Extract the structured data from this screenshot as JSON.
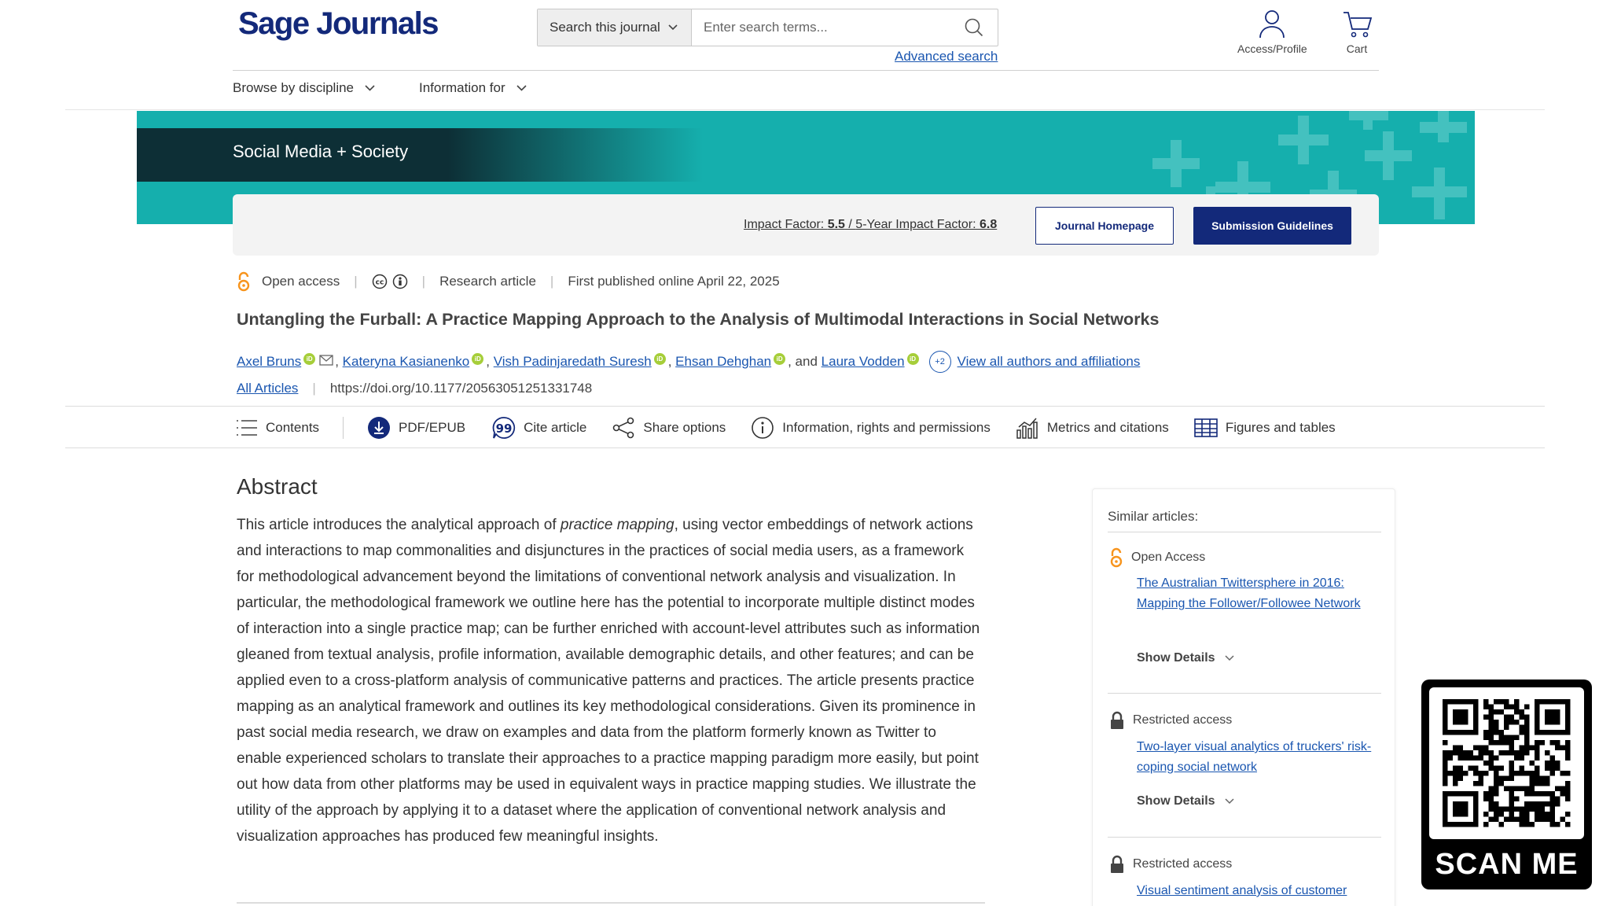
{
  "header": {
    "logo": "Sage Journals",
    "search_scope": "Search this journal",
    "search_placeholder": "Enter search terms...",
    "advanced_search": "Advanced search",
    "access_profile": "Access/Profile",
    "cart": "Cart"
  },
  "nav": {
    "browse": "Browse by discipline",
    "information": "Information for"
  },
  "journal": {
    "name": "Social Media + Society",
    "impact_label": "Impact Factor: ",
    "impact_value": "5.5",
    "impact_sep": " / ",
    "five_year_label": "5-Year Impact Factor: ",
    "five_year_value": "6.8",
    "homepage_button": "Journal Homepage",
    "guidelines_button": "Submission Guidelines"
  },
  "article": {
    "access": "Open access",
    "type": "Research article",
    "published": "First published online April 22, 2025",
    "title": "Untangling the Furball: A Practice Mapping Approach to the Analysis of Multimodal Interactions in Social Networks",
    "authors": [
      "Axel Bruns",
      "Kateryna Kasianenko",
      "Vish Padinjaredath Suresh",
      "Ehsan Dehghan",
      "Laura Vodden"
    ],
    "and_text": ", and ",
    "more_count": "+2",
    "view_all": "View all authors and affiliations",
    "all_articles": "All Articles",
    "doi": "https://doi.org/10.1177/20563051251331748"
  },
  "toolbar": {
    "contents": "Contents",
    "pdf": "PDF/EPUB",
    "cite": "Cite article",
    "share": "Share options",
    "info": "Information, rights and permissions",
    "metrics": "Metrics and citations",
    "figures": "Figures and tables"
  },
  "abstract": {
    "heading": "Abstract",
    "text_before": "This article introduces the analytical approach of ",
    "text_italic": "practice mapping",
    "text_after": ", using vector embeddings of network actions and interactions to map commonalities and disjunctures in the practices of social media users, as a framework for methodological advancement beyond the limitations of conventional network analysis and visualization. In particular, the methodological framework we outline here has the potential to incorporate multiple distinct modes of interaction into a single practice map; can be further enriched with account-level attributes such as information gleaned from textual analysis, profile information, available demographic details, and other features; and can be applied even to a cross-platform analysis of communicative patterns and practices. The article presents practice mapping as an analytical framework and outlines its key methodological considerations. Given its prominence in past social media research, we draw on examples and data from the platform formerly known as Twitter to enable experienced scholars to translate their approaches to a practice mapping paradigm more easily, but point out how data from other platforms may be used in equivalent ways in practice mapping studies. We illustrate the utility of the approach by applying it to a dataset where the application of conventional network analysis and visualization approaches has produced few meaningful insights."
  },
  "similar": {
    "heading": "Similar articles:",
    "show_details": "Show Details",
    "items": [
      {
        "access": "Open Access",
        "title": "The Australian Twittersphere in 2016: Mapping the Follower/Followee Network"
      },
      {
        "access": "Restricted access",
        "title": "Two-layer visual analytics of truckers' risk-coping social network"
      },
      {
        "access": "Restricted access",
        "title": "Visual sentiment analysis of customer"
      }
    ]
  },
  "qr": {
    "label": "SCAN ME"
  },
  "colors": {
    "brand_navy": "#13297a",
    "banner_teal": "#15afad",
    "banner_dark": "#0d2f36",
    "link_blue": "#1a56b0",
    "open_access_orange": "#f7941d",
    "orcid_green": "#a6ce39"
  }
}
